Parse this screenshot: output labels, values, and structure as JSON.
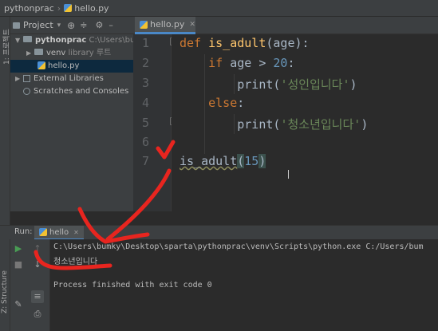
{
  "navbar": {
    "project": "pythonprac",
    "file": "hello.py"
  },
  "left_stripe": {
    "project_tab": "1: 프로젝트",
    "structure_tab": "Z: Structure"
  },
  "project_panel": {
    "title": "Project",
    "items": [
      {
        "label": "pythonprac",
        "hint": "C:\\Users\\bum",
        "kind": "folder",
        "expanded": true
      },
      {
        "label": "venv",
        "hint": "library 루트",
        "kind": "folder",
        "expanded": false
      },
      {
        "label": "hello.py",
        "hint": "",
        "kind": "python-file",
        "selected": true
      },
      {
        "label": "External Libraries",
        "hint": "",
        "kind": "library",
        "expanded": false
      },
      {
        "label": "Scratches and Consoles",
        "hint": "",
        "kind": "scratches"
      }
    ]
  },
  "editor": {
    "tab": "hello.py",
    "line_numbers": [
      "1",
      "2",
      "3",
      "4",
      "5",
      "6",
      "7"
    ],
    "code": {
      "l1": {
        "kw": "def",
        "name": "is_adult",
        "rest": "(age):"
      },
      "l2": {
        "kw": "if",
        "mid": "age > ",
        "num": "20",
        "end": ":"
      },
      "l3": {
        "fn": "print",
        "open": "(",
        "str": "'성인입니다'",
        "close": ")"
      },
      "l4": {
        "kw": "else",
        "end": ":"
      },
      "l5": {
        "fn": "print",
        "open": "(",
        "str": "'청소년입니다'",
        "close": ")"
      },
      "l7": {
        "call": "is_adult",
        "open": "(",
        "num": "15",
        "close": ")"
      }
    }
  },
  "run_panel": {
    "label": "Run:",
    "tab": "hello",
    "output": [
      "C:\\Users\\bumky\\Desktop\\sparta\\pythonprac\\venv\\Scripts\\python.exe C:/Users/bum",
      "청소년입니다",
      "",
      "Process finished with exit code 0"
    ]
  },
  "annotation": {
    "color": "#e8251f"
  },
  "colors": {
    "accent": "#4a88c7",
    "keyword": "#cc7832",
    "function": "#ffc66d",
    "number": "#6897bb",
    "string": "#6a8759"
  }
}
